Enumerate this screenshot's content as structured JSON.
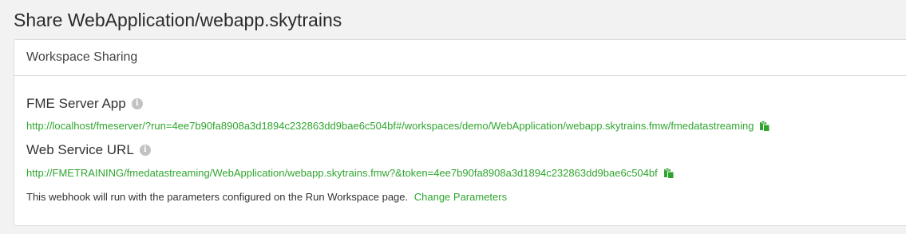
{
  "page": {
    "title": "Share WebApplication/webapp.skytrains"
  },
  "panel": {
    "title": "Workspace Sharing",
    "fme_app": {
      "label": "FME Server App",
      "icon": "info-icon",
      "url": "http://localhost/fmeserver/?run=4ee7b90fa8908a3d1894c232863dd9bae6c504bf#/workspaces/demo/WebApplication/webapp.skytrains.fmw/fmedatastreaming",
      "copy_icon": "copy-icon"
    },
    "web_service": {
      "label": "Web Service URL",
      "icon": "info-icon",
      "url": "http://FMETRAINING/fmedatastreaming/WebApplication/webapp.skytrains.fmw?&token=4ee7b90fa8908a3d1894c232863dd9bae6c504bf",
      "copy_icon": "copy-icon"
    },
    "note": {
      "text": "This webhook will run with the parameters configured on the Run Workspace page.",
      "link": "Change Parameters"
    }
  },
  "colors": {
    "link": "#2fa52f",
    "info_icon": "#c2c2c2",
    "background": "#f2f2f2"
  }
}
